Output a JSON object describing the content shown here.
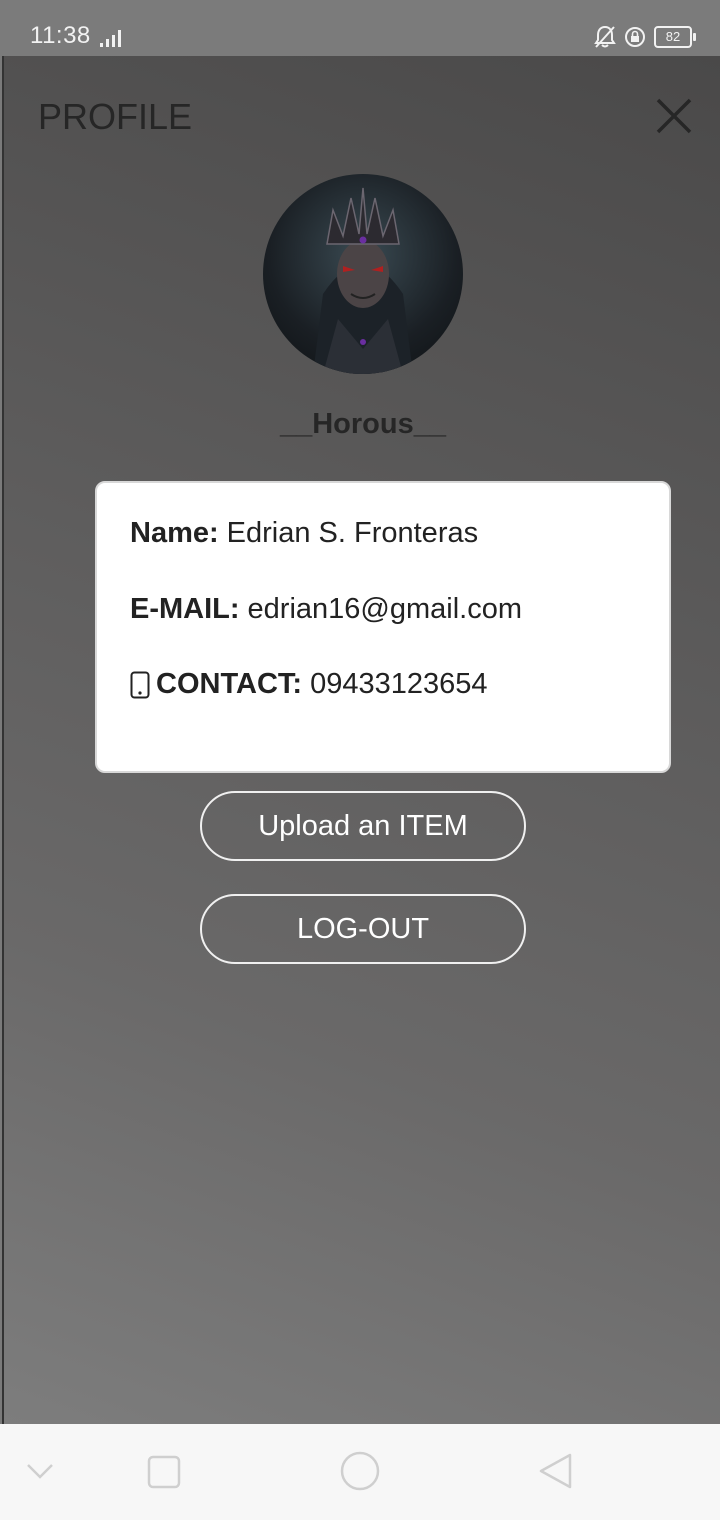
{
  "status_bar": {
    "time": "11:38",
    "battery": "82",
    "icons": [
      "signal-icon",
      "bell-off-icon",
      "rotation-lock-icon",
      "battery-icon"
    ]
  },
  "header": {
    "title": "PROFILE",
    "close_icon": "close-icon"
  },
  "profile": {
    "username": "__Horous__",
    "name_label": "Name:",
    "name_value": "Edrian S. Fronteras",
    "email_label": "E-MAIL:",
    "email_value": "edrian16@gmail.com",
    "contact_label": "CONTACT:",
    "contact_value": "09433123654"
  },
  "actions": {
    "upload_label": "Upload an ITEM",
    "logout_label": "LOG-OUT"
  },
  "nav_bar": {
    "items": [
      "chevron-down-icon",
      "recent-apps-icon",
      "home-icon",
      "back-icon"
    ]
  },
  "colors": {
    "card_bg": "#ffffff",
    "title_text": "#262626",
    "button_border": "#f0f0f0"
  }
}
